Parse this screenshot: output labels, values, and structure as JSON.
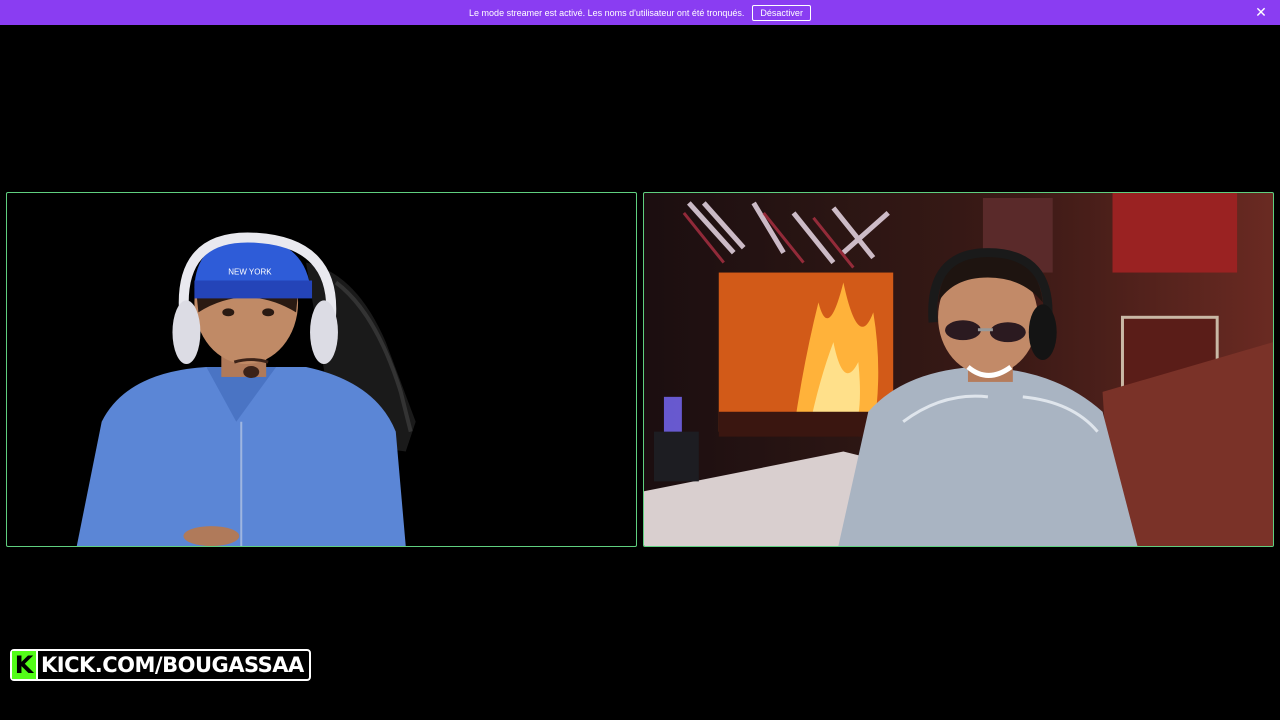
{
  "banner": {
    "message": "Le mode streamer est activé. Les noms d'utilisateur ont été tronqués.",
    "button_label": "Désactiver",
    "close_glyph": "✕"
  },
  "video": {
    "left_cam": {
      "cap_text": "NEW YORK"
    },
    "right_cam": {}
  },
  "watermark": {
    "k_letter": "K",
    "url_text": "KICK.COM/BOUGASSAA",
    "accent_color": "#53fc18"
  },
  "colors": {
    "banner_bg": "#8a3df2",
    "cam_border": "#5fcf7f"
  }
}
